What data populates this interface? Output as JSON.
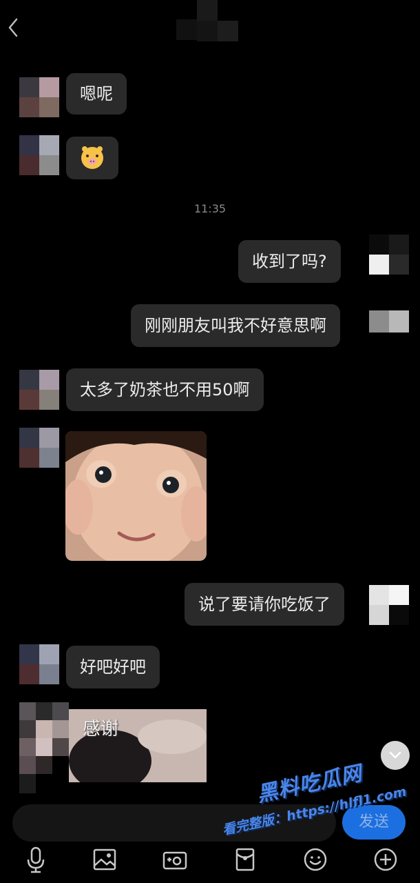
{
  "header": {
    "title_hidden": ""
  },
  "messages": [
    {
      "side": "left",
      "text": "嗯呢"
    },
    {
      "side": "left",
      "emoji": "pig-face"
    },
    {
      "time": "11:35"
    },
    {
      "side": "right",
      "text": "收到了吗?"
    },
    {
      "side": "right",
      "text": "刚刚朋友叫我不好意思啊"
    },
    {
      "side": "left",
      "text": "太多了奶茶也不用50啊"
    },
    {
      "side": "left",
      "image": "child-face-sticker"
    },
    {
      "side": "right",
      "text": "说了要请你吃饭了"
    },
    {
      "side": "left",
      "text": "好吧好吧"
    },
    {
      "side": "left",
      "image": "thanks-sticker",
      "caption": "感谢"
    }
  ],
  "input": {
    "send_label": "发送"
  },
  "watermark": {
    "line1": "黑料吃瓜网",
    "line2": "看完整版：https://hlfl1.com"
  },
  "toolbar": [
    "microphone-icon",
    "image-icon",
    "camera-icon",
    "red-packet-icon",
    "emoji-icon",
    "plus-icon"
  ],
  "colors": {
    "bubble": "#2a2a2a",
    "accent": "#1c6fe0",
    "background": "#000000"
  }
}
